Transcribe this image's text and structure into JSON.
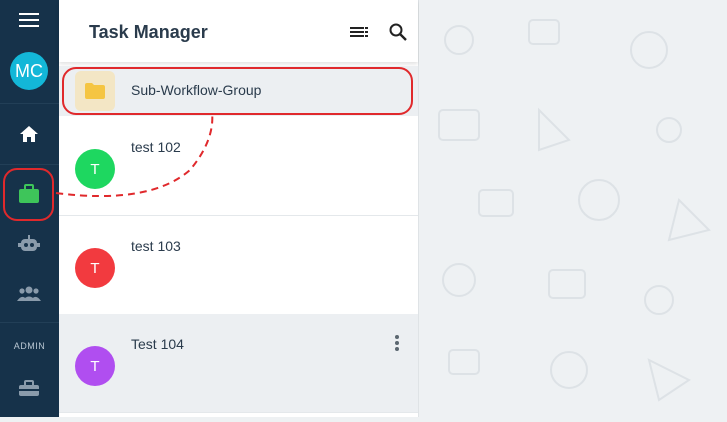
{
  "rail": {
    "avatar_initials": "MC",
    "admin_label": "ADMIN",
    "icons": [
      "menu-icon",
      "home-icon",
      "briefcase-icon",
      "robot-icon",
      "group-icon",
      "toolbox-icon"
    ]
  },
  "panel": {
    "title": "Task Manager",
    "header_icons": [
      "list-filter-icon",
      "search-icon"
    ],
    "group": {
      "label": "Sub-Workflow-Group",
      "icon": "folder-icon"
    },
    "tasks": [
      {
        "initial": "T",
        "name": "test 102",
        "color": "#1ed760"
      },
      {
        "initial": "T",
        "name": "test 103",
        "color": "#f23a3f"
      },
      {
        "initial": "T",
        "name": "Test 104",
        "color": "#b04ef0"
      }
    ]
  },
  "colors": {
    "rail": "#16324a",
    "accent": "#13b7d8",
    "highlight": "#e0292c",
    "briefcase": "#3ec55a"
  }
}
